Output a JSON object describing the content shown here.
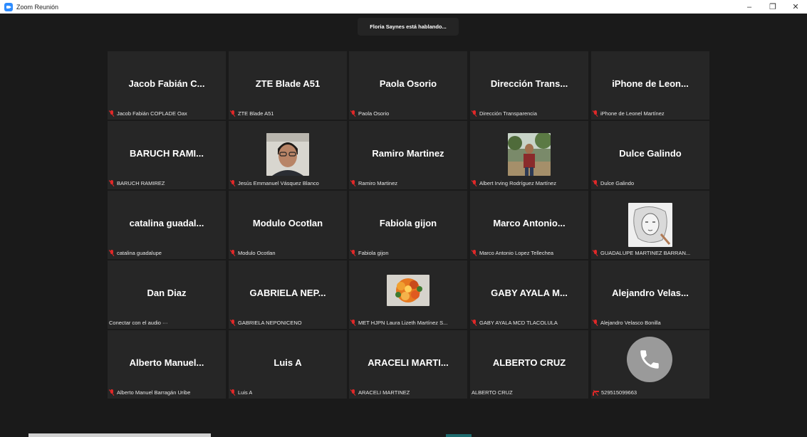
{
  "window": {
    "title": "Zoom Reunión"
  },
  "speaker": {
    "text": "Floria Saynes está hablando..."
  },
  "tiles": [
    {
      "name": "Jacob Fabián C...",
      "label": "Jacob Fabián COPLADE Oax",
      "status": "muted"
    },
    {
      "name": "ZTE Blade A51",
      "label": "ZTE Blade A51",
      "status": "muted"
    },
    {
      "name": "Paola Osorio",
      "label": "Paola Osorio",
      "status": "muted"
    },
    {
      "name": "Dirección Trans...",
      "label": "Dirección Transparencia",
      "status": "muted"
    },
    {
      "name": "iPhone de Leon...",
      "label": "iPhone de Leonel Martínez",
      "status": "muted"
    },
    {
      "name": "BARUCH RAMI...",
      "label": "BARUCH RAMIREZ",
      "status": "muted"
    },
    {
      "name": "",
      "label": "Jesús Emmanuel Vásquez Blanco",
      "status": "muted",
      "photo": "man-portrait"
    },
    {
      "name": "Ramiro Martinez",
      "label": "Ramiro Martinez",
      "status": "muted"
    },
    {
      "name": "",
      "label": "Albert Irving Rodríguez Martínez",
      "status": "muted",
      "photo": "outdoor-man"
    },
    {
      "name": "Dulce Galindo",
      "label": "Dulce Galindo",
      "status": "muted"
    },
    {
      "name": "catalina guadal...",
      "label": "catalina guadalupe",
      "status": "muted"
    },
    {
      "name": "Modulo Ocotlan",
      "label": "Modulo Ocotlan",
      "status": "muted"
    },
    {
      "name": "Fabiola gijon",
      "label": "Fabiola gijon",
      "status": "muted"
    },
    {
      "name": "Marco Antonio...",
      "label": "Marco Antonio Lopez Tellechea",
      "status": "muted"
    },
    {
      "name": "",
      "label": "GUADALUPE MARTINEZ BARRAN...",
      "status": "muted",
      "photo": "sketch"
    },
    {
      "name": "Dan Diaz",
      "label": "Conectar con el audio ···",
      "status": "none"
    },
    {
      "name": "GABRIELA NEP...",
      "label": "GABRIELA NEPONICENO",
      "status": "muted"
    },
    {
      "name": "",
      "label": "MET HJPN Laura Lizeth Martínez S...",
      "status": "muted",
      "photo": "flowers"
    },
    {
      "name": "GABY AYALA M...",
      "label": "GABY AYALA MCD TLACOLULA",
      "status": "muted"
    },
    {
      "name": "Alejandro Velas...",
      "label": "Alejandro Velasco Bonilla",
      "status": "muted"
    },
    {
      "name": "Alberto Manuel...",
      "label": "Alberto Manuel Barragán Uribe",
      "status": "muted"
    },
    {
      "name": "Luis A",
      "label": "Luis A",
      "status": "muted"
    },
    {
      "name": "ARACELI MARTI...",
      "label": "ARACELI MARTINEZ",
      "status": "muted"
    },
    {
      "name": "ALBERTO CRUZ",
      "label": "ALBERTO CRUZ",
      "status": "none"
    },
    {
      "name": "",
      "label": "529515099663",
      "status": "phone-muted",
      "photo": "phone-call"
    }
  ],
  "colors": {
    "muted": "#e02828",
    "tile_bg": "#262626",
    "background": "#1a1a1a"
  }
}
